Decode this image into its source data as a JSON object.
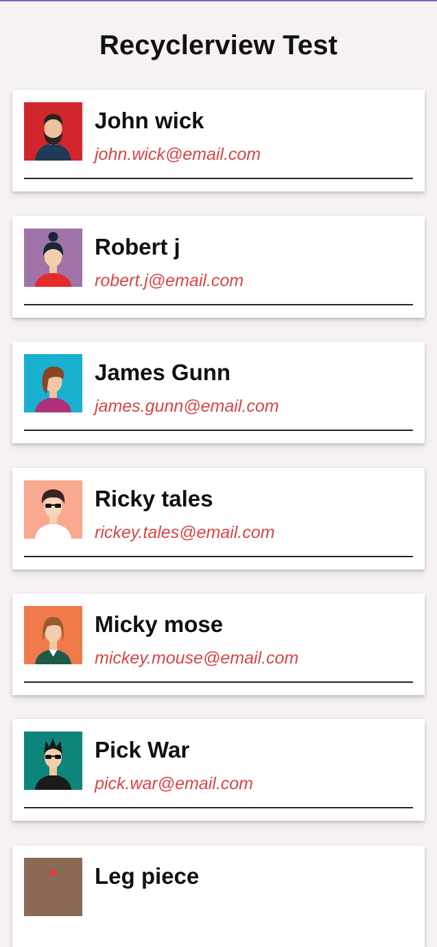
{
  "app": {
    "title": "Recyclerview Test"
  },
  "users": [
    {
      "name": "John wick",
      "email": "john.wick@email.com",
      "avatar_icon": "man-beard-avatar-icon",
      "avatar_bg": "#d0262c"
    },
    {
      "name": "Robert j",
      "email": "robert.j@email.com",
      "avatar_icon": "woman-bun-avatar-icon",
      "avatar_bg": "#a074a8"
    },
    {
      "name": "James Gunn",
      "email": "james.gunn@email.com",
      "avatar_icon": "woman-brown-hair-avatar-icon",
      "avatar_bg": "#1ab0d0"
    },
    {
      "name": "Ricky tales",
      "email": "rickey.tales@email.com",
      "avatar_icon": "man-curly-sunglasses-avatar-icon",
      "avatar_bg": "#f8a98f"
    },
    {
      "name": "Micky mose",
      "email": "mickey.mouse@email.com",
      "avatar_icon": "woman-bob-avatar-icon",
      "avatar_bg": "#f07a4a"
    },
    {
      "name": "Pick War",
      "email": "pick.war@email.com",
      "avatar_icon": "man-spiky-sunglasses-avatar-icon",
      "avatar_bg": "#0e857a"
    },
    {
      "name": "Leg piece",
      "email": "",
      "avatar_icon": "partial-avatar-icon",
      "avatar_bg": "#8a6a55"
    }
  ],
  "colors": {
    "email_text": "#d64545",
    "background": "#f5f2f1",
    "top_line": "#7a68b0"
  }
}
